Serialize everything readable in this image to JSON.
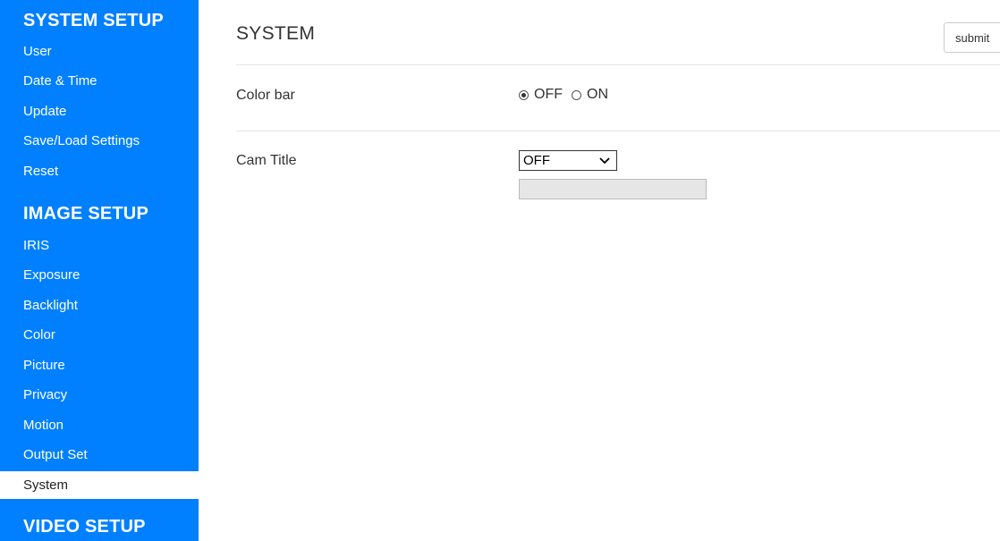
{
  "sidebar": {
    "sections": [
      {
        "title": "SYSTEM SETUP",
        "items": [
          "User",
          "Date & Time",
          "Update",
          "Save/Load Settings",
          "Reset"
        ]
      },
      {
        "title": "IMAGE SETUP",
        "items": [
          "IRIS",
          "Exposure",
          "Backlight",
          "Color",
          "Picture",
          "Privacy",
          "Motion",
          "Output Set",
          "System"
        ]
      },
      {
        "title": "VIDEO SETUP",
        "items": []
      }
    ],
    "active_item": "System",
    "colors": {
      "background": "#0080ff",
      "text": "#ffffff",
      "active_bg": "#ffffff"
    }
  },
  "main": {
    "title": "SYSTEM",
    "submit_label": "submit",
    "color_bar": {
      "label": "Color bar",
      "options": [
        "OFF",
        "ON"
      ],
      "selected": "OFF"
    },
    "cam_title": {
      "label": "Cam Title",
      "select_value": "OFF",
      "text_value": ""
    }
  }
}
